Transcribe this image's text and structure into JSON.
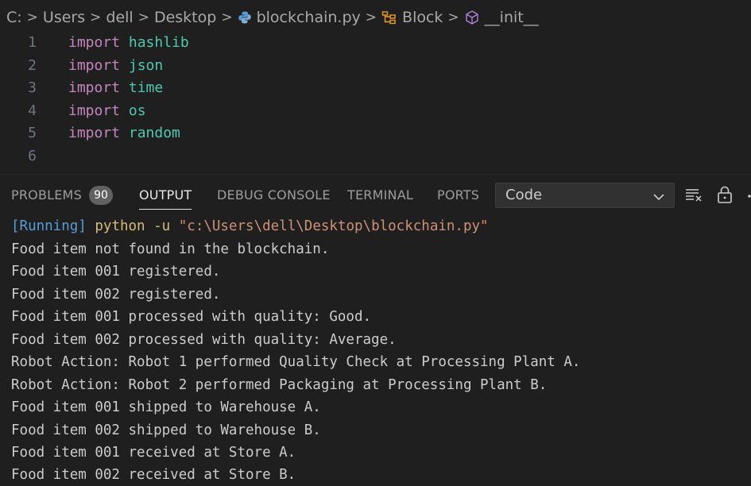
{
  "breadcrumb": {
    "items": [
      "C:",
      "Users",
      "dell",
      "Desktop",
      "blockchain.py",
      "Block",
      "__init__"
    ],
    "separator": ">"
  },
  "editor": {
    "lines": [
      {
        "num": "1",
        "kw": "import",
        "mod": "hashlib"
      },
      {
        "num": "2",
        "kw": "import",
        "mod": "json"
      },
      {
        "num": "3",
        "kw": "import",
        "mod": "time"
      },
      {
        "num": "4",
        "kw": "import",
        "mod": "os"
      },
      {
        "num": "5",
        "kw": "import",
        "mod": "random"
      },
      {
        "num": "6",
        "kw": "",
        "mod": ""
      }
    ]
  },
  "panel": {
    "tabs": [
      "PROBLEMS",
      "OUTPUT",
      "DEBUG CONSOLE",
      "TERMINAL",
      "PORTS"
    ],
    "active_tab": "OUTPUT",
    "problems_count": "90",
    "channel_select": "Code"
  },
  "output": {
    "running_prefix": "[Running]",
    "command": "python -u",
    "command_path": "\"c:\\Users\\dell\\Desktop\\blockchain.py\"",
    "lines": [
      "Food item not found in the blockchain.",
      "Food item 001 registered.",
      "Food item 002 registered.",
      "Food item 001 processed with quality: Good.",
      "Food item 002 processed with quality: Average.",
      "Robot Action: Robot 1 performed Quality Check at Processing Plant A.",
      "Robot Action: Robot 2 performed Packaging at Processing Plant B.",
      "Food item 001 shipped to Warehouse A.",
      "Food item 002 shipped to Warehouse B.",
      "Food item 001 received at Store A.",
      "Food item 002 received at Store B."
    ]
  },
  "colors": {
    "background": "#1f1f1f",
    "keyword": "#c586c0",
    "module": "#4ec9b0",
    "running": "#569cd6",
    "command_string": "#ce9178"
  },
  "icons": [
    "python-file-icon",
    "class-icon",
    "method-cube-icon",
    "clear-output-icon",
    "lock-icon",
    "more-icon"
  ]
}
